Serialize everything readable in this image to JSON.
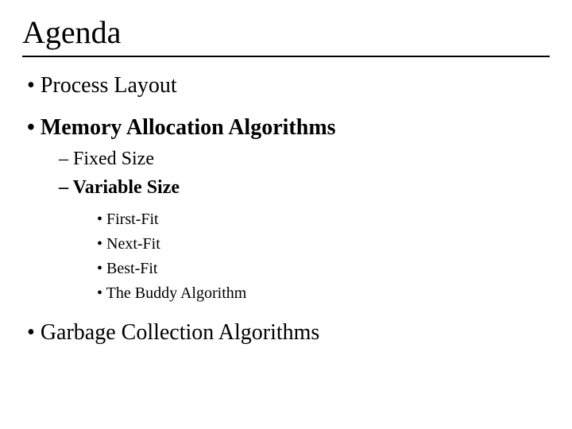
{
  "title": "Agenda",
  "items": [
    {
      "text": "Process Layout",
      "bold": false
    },
    {
      "text": "Memory Allocation Algorithms",
      "bold": true,
      "children": [
        {
          "text": "Fixed Size",
          "bold": false
        },
        {
          "text": "Variable Size",
          "bold": true,
          "children": [
            {
              "text": "First-Fit"
            },
            {
              "text": "Next-Fit"
            },
            {
              "text": "Best-Fit"
            },
            {
              "text": "The Buddy Algorithm"
            }
          ]
        }
      ]
    },
    {
      "text": "Garbage Collection Algorithms",
      "bold": false
    }
  ]
}
